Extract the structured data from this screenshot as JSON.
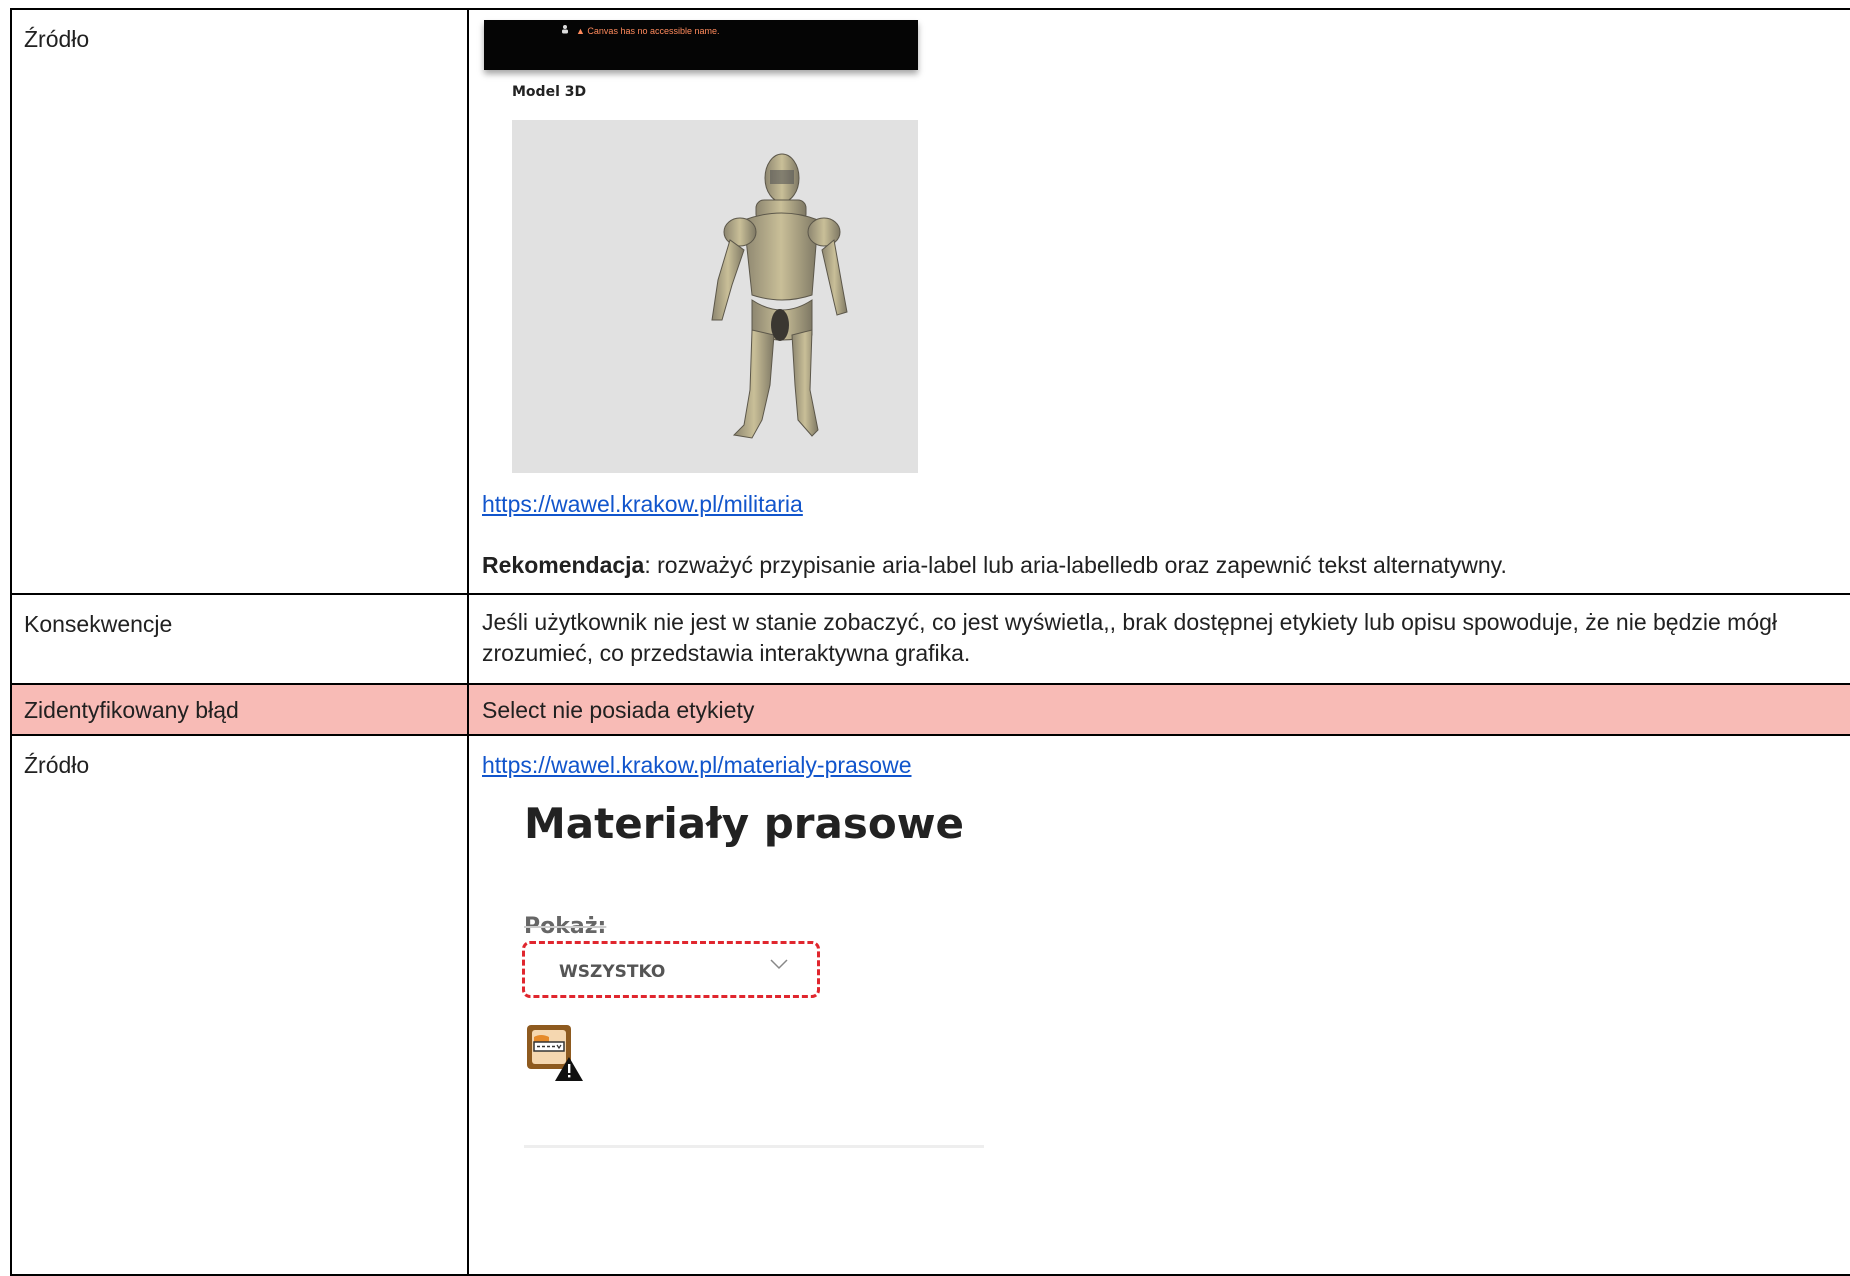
{
  "rows": {
    "source1": {
      "label": "Źródło",
      "screenshot": {
        "warning": "Canvas has no accessible name.",
        "title": "Model 3D"
      },
      "link": "https://wawel.krakow.pl/militaria",
      "recommendation_label": "Rekomendacja",
      "recommendation_text": ": rozważyć przypisanie aria-label lub aria-labelledb oraz zapewnić tekst alternatywny."
    },
    "consequences": {
      "label": "Konsekwencje",
      "text": "Jeśli użytkownik nie jest w stanie zobaczyć, co jest wyświetla,, brak dostępnej etykiety lub opisu spowoduje, że nie będzie mógł zrozumieć, co przedstawia interaktywna grafika."
    },
    "error": {
      "label": "Zidentyfikowany błąd",
      "text": "Select nie posiada etykiety"
    },
    "source2": {
      "label": "Źródło",
      "link": "https://wawel.krakow.pl/materialy-prasowe",
      "screenshot": {
        "title": "Materiały prasowe",
        "show_label": "Pokaż:",
        "select_value": "WSZYSTKO"
      }
    }
  },
  "colors": {
    "error_row_bg": "#f8bbb6",
    "link": "#1155cc",
    "dashed_outline": "#e0262e"
  }
}
